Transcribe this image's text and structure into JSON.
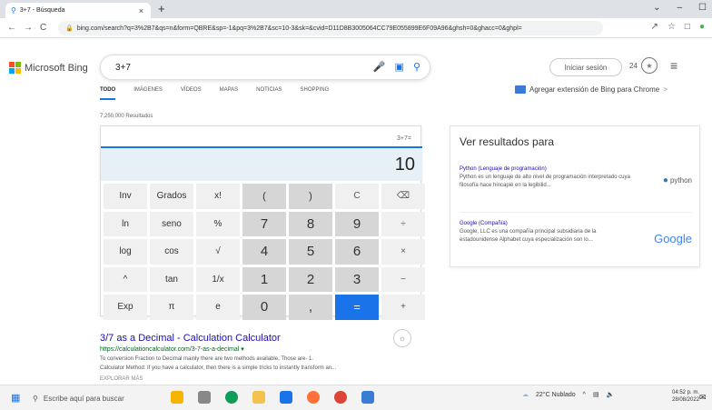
{
  "browser": {
    "tab_title": "3+7 - Búsqueda",
    "tab_close": "×",
    "new_tab": "+",
    "url": "bing.com/search?q=3%2B7&qs=n&form=QBRE&sp=-1&pq=3%2B7&sc=10-3&sk=&cvid=D11D8B3005064CC79E055899E6F09A96&ghsh=0&ghacc=0&ghpl=",
    "back": "←",
    "forward": "→",
    "reload": "C",
    "win_min": "–",
    "win_max": "☐",
    "win_chevron": "⌄"
  },
  "header": {
    "logo_text": "Microsoft Bing",
    "query": "3+7",
    "signin": "Iniciar sesión",
    "points": "24",
    "tabs": [
      "TODO",
      "IMÁGENES",
      "VÍDEOS",
      "MAPAS",
      "NOTICIAS",
      "SHOPPING"
    ],
    "extension_text": "Agregar extensión de Bing para Chrome",
    "extension_arrow": ">"
  },
  "results_count": "7,250,000 Resultados",
  "calculator": {
    "expression": "3+7=",
    "display": "10",
    "keys": [
      [
        "Inv",
        "Grados",
        "x!",
        "(",
        ")",
        "C",
        "⌫"
      ],
      [
        "ln",
        "seno",
        "%",
        "7",
        "8",
        "9",
        "÷"
      ],
      [
        "log",
        "cos",
        "√",
        "4",
        "5",
        "6",
        "×"
      ],
      [
        "^",
        "tan",
        "1/x",
        "1",
        "2",
        "3",
        "−"
      ],
      [
        "Exp",
        "π",
        "e",
        "0",
        ",",
        "=",
        "+"
      ]
    ]
  },
  "result1": {
    "title": "3/7 as a Decimal - Calculation Calculator",
    "url": "https://calculationcalculator.com/3-7-as-a-decimal",
    "url_arrow": "▾",
    "desc1": "To conversion Fraction to Decimal mainly there are two methods available, Those are- 1.",
    "desc2": "Calculator Method: If you have a calculator, then there is a simple tricks to instantly transform an..."
  },
  "more_label": "EXPLORAR MÁS",
  "card": {
    "title": "Ver resultados para",
    "entities": [
      {
        "name": "Python (Lenguaje de programación)",
        "desc": "Python es un lenguaje de alto nivel de programación interpretado cuya filosofía hace hincapié en la legibilid...",
        "logo": "python"
      },
      {
        "name": "Google (Compañía)",
        "desc": "Google, LLC es una compañía principal subsidiaria de la estadounidense Alphabet cuya especialización son lo...",
        "logo": "Google"
      }
    ]
  },
  "taskbar": {
    "search_placeholder": "Escribe aquí para buscar",
    "weather": "22°C Nublado",
    "time": "04:52 p. m.",
    "date": "28/08/2022",
    "tray_chevron": "^"
  }
}
